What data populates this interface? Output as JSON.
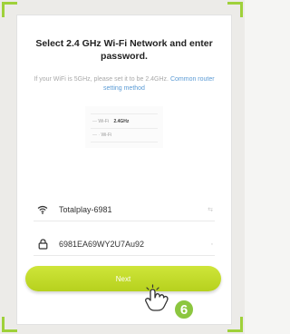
{
  "dialog": {
    "title": "Select 2.4 GHz Wi-Fi Network and enter password.",
    "hint_prefix": "If your WiFi is 5GHz, please set it to be 2.4GHz.",
    "hint_link": "Common router setting method"
  },
  "illustration": {
    "row1_label": "Wi-Fi",
    "row1_value": "2.4GHz",
    "row1_sep": "—",
    "row2_label": "Wi-Fi",
    "row2_sep": "— ·"
  },
  "wifi": {
    "ssid": "Totalplay-6981",
    "trail": "⇆"
  },
  "password": {
    "value": "6981EA69WY2U7Au92",
    "trail": "◦"
  },
  "next": {
    "label": "Next"
  },
  "step": {
    "number": "6"
  },
  "colors": {
    "accent": "#bdd62a",
    "bracket": "#9fd13a",
    "badge": "#8cc63f",
    "link": "#5b9bd5"
  }
}
